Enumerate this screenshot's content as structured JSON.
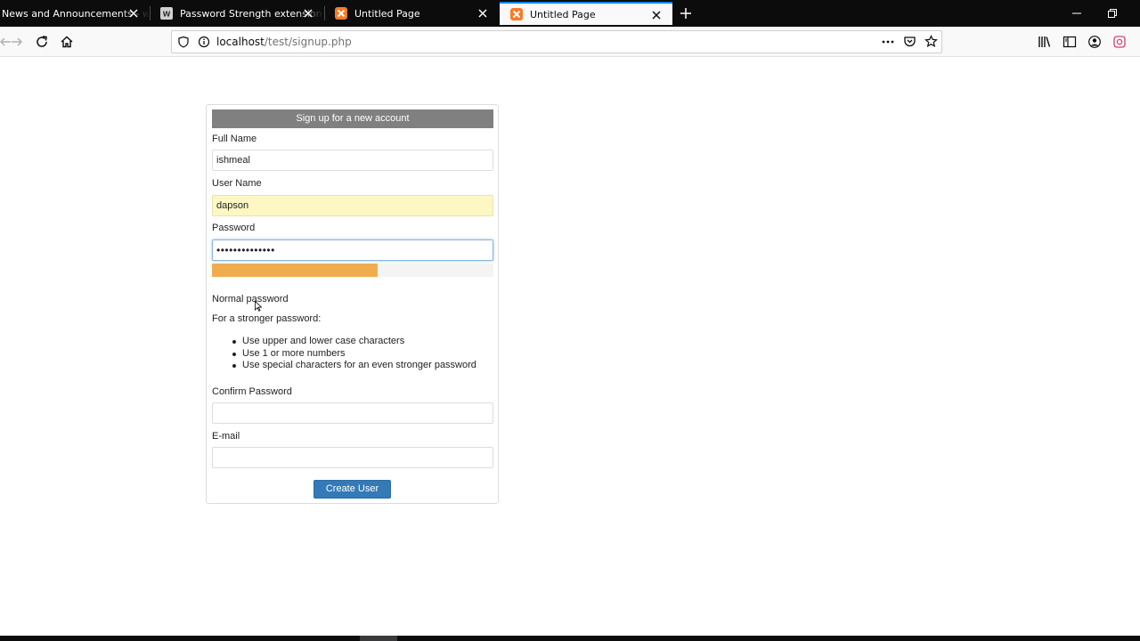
{
  "browser": {
    "tabs": [
      {
        "title": "News and Announcements - w",
        "icon": "globe-icon",
        "active": false
      },
      {
        "title": "Password Strength extension re",
        "icon": "wordpress-icon",
        "active": false
      },
      {
        "title": "Untitled Page",
        "icon": "xampp-icon",
        "active": false
      },
      {
        "title": "Untitled Page",
        "icon": "xampp-icon",
        "active": true
      }
    ],
    "url": {
      "host": "localhost",
      "path": "/test/signup.php"
    }
  },
  "form": {
    "heading": "Sign up for a new account",
    "full_name": {
      "label": "Full Name",
      "value": "ishmeal"
    },
    "user_name": {
      "label": "User Name",
      "value": "dapson"
    },
    "password": {
      "label": "Password",
      "value": "••••••••••••••"
    },
    "strength": {
      "label": "Normal password",
      "level": 0.59,
      "color": "#f0ad4e"
    },
    "advice": {
      "heading": "For a stronger password:",
      "items": [
        "Use upper and lower case characters",
        "Use 1 or more numbers",
        "Use special characters for an even stronger password"
      ]
    },
    "confirm_password": {
      "label": "Confirm Password",
      "value": ""
    },
    "email": {
      "label": "E-mail",
      "value": ""
    },
    "submit_label": "Create User"
  },
  "colors": {
    "accent": "#0a84ff",
    "button": "#337ab7",
    "header": "#808080",
    "autofill": "#fdf7c4"
  }
}
